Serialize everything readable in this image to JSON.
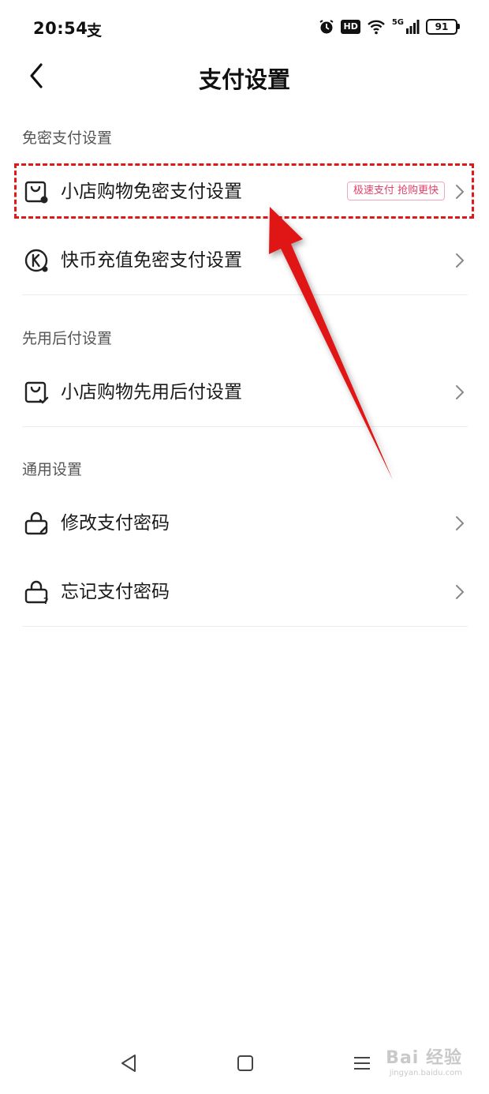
{
  "status_bar": {
    "time": "20:54",
    "pay_glyph": "支",
    "network": "5G",
    "hd": "HD",
    "battery": "91"
  },
  "header": {
    "title": "支付设置"
  },
  "sections": [
    {
      "label": "免密支付设置",
      "items": [
        {
          "label": "小店购物免密支付设置",
          "tag": "极速支付 抢购更快",
          "icon": "shopping-bag-pay-icon"
        },
        {
          "label": "快币充值免密支付设置",
          "icon": "kuaibi-coin-icon"
        }
      ]
    },
    {
      "label": "先用后付设置",
      "items": [
        {
          "label": "小店购物先用后付设置",
          "icon": "shopping-bag-check-icon"
        }
      ]
    },
    {
      "label": "通用设置",
      "items": [
        {
          "label": "修改支付密码",
          "icon": "lock-edit-icon"
        },
        {
          "label": "忘记支付密码",
          "icon": "lock-question-icon"
        }
      ]
    }
  ],
  "watermark": {
    "brand": "Bai 经验",
    "url": "jingyan.baidu.com"
  },
  "colors": {
    "accent_tag_text": "#e0416a",
    "accent_tag_border": "#f3a8ba",
    "annotation": "#e01818"
  }
}
